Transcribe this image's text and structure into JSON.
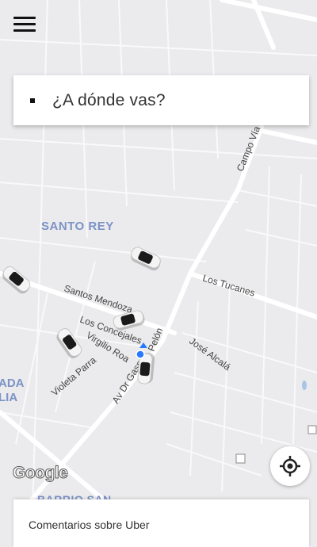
{
  "header": {
    "menu_icon": "hamburger-menu-icon"
  },
  "search": {
    "placeholder": "¿A dónde vas?"
  },
  "map": {
    "neighborhoods": [
      "SANTO REY",
      "ADA",
      "LIA",
      "BARRIO SAN"
    ],
    "streets": [
      "Campo Vía",
      "Los Tucanes",
      "Santos Mendoza",
      "Los Concejales",
      "Virgilio Roa",
      "Violeta Parra",
      "Av Dr Gaspar",
      "Pelón",
      "José Alcalá"
    ],
    "attribution": "Google",
    "car_icon": "car-icon",
    "user_location_icon": "user-location-dot-icon"
  },
  "locate": {
    "icon": "crosshair-location-icon"
  },
  "footer": {
    "feedback_label": "Comentarios sobre Uber"
  },
  "colors": {
    "map_bg": "#ebebed",
    "road": "#ffffff",
    "label": "#7c93c6",
    "location": "#2979ff"
  }
}
